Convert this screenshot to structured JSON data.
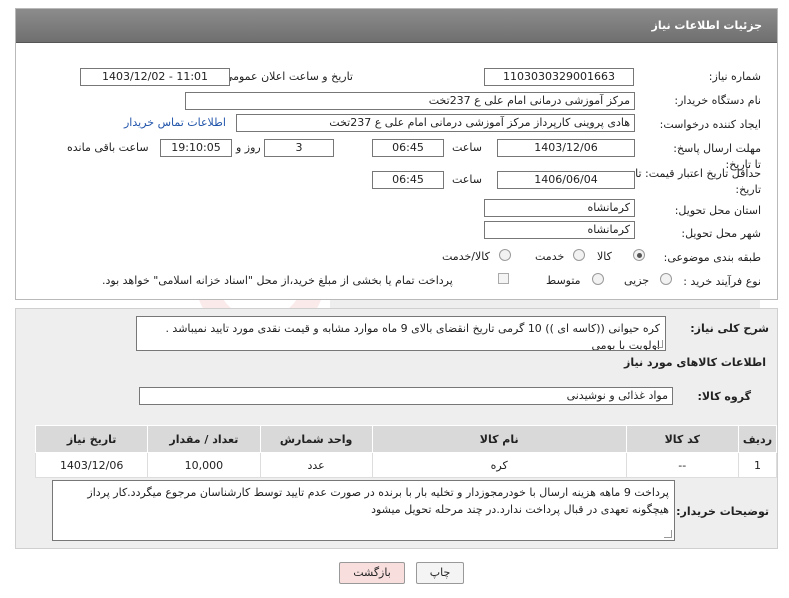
{
  "header": {
    "title": "جزئیات اطلاعات نیاز"
  },
  "fields": {
    "need_number_label": "شماره نیاز:",
    "need_number": "1103030329001663",
    "announce_label": "تاریخ و ساعت اعلان عمومی:",
    "announce_value": "1403/12/02 - 11:01",
    "buyer_org_label": "نام دستگاه خریدار:",
    "buyer_org": "مرکز آموزشی درمانی امام علی ع 237تخت",
    "creator_label": "ایجاد کننده درخواست:",
    "creator": "هادی پروینی کارپرداز  مرکز آموزشی درمانی امام علی ع 237تخت",
    "contact_link": "اطلاعات تماس خریدار",
    "deadline_label": "مهلت ارسال پاسخ: تا تاریخ:",
    "deadline_date": "1403/12/06",
    "time_label": "ساعت",
    "deadline_time": "06:45",
    "days_value": "3",
    "days_label": "روز و",
    "remaining_time": "19:10:05",
    "remaining_label": "ساعت باقی مانده",
    "validity_label": "حداقل تاریخ اعتبار قیمت: تا تاریخ:",
    "validity_date": "1406/06/04",
    "validity_time": "06:45",
    "province_label": "استان محل تحویل:",
    "province": "کرمانشاه",
    "city_label": "شهر محل تحویل:",
    "city": "کرمانشاه",
    "category_label": "طبقه بندی موضوعی:",
    "category_options": [
      "کالا",
      "خدمت",
      "کالا/خدمت"
    ],
    "process_label": "نوع فرآیند خرید :",
    "process_options": [
      "جزیی",
      "متوسط"
    ],
    "payment_note": "پرداخت تمام یا بخشی از مبلغ خرید،از محل \"اسناد خزانه اسلامی\" خواهد بود."
  },
  "summary": {
    "label": "شرح کلی نیاز:",
    "text": "کره حیوانی ((کاسه ای ))  10 گرمی  تاریخ انقضای بالای 9 ماه  موارد مشابه و قیمت نقدی مورد تایید نمیباشد . اولویت با بومی"
  },
  "goods_info_title": "اطلاعات کالاهای مورد نیاز",
  "goods_group": {
    "label": "گروه کالا:",
    "value": "مواد غذائی و نوشیدنی"
  },
  "table": {
    "headers": [
      "ردیف",
      "کد کالا",
      "نام کالا",
      "واحد شمارش",
      "تعداد / مقدار",
      "تاریخ نیاز"
    ],
    "rows": [
      [
        "1",
        "--",
        "کره",
        "عدد",
        "10,000",
        "1403/12/06"
      ]
    ]
  },
  "buyer_notes": {
    "label": "توضیحات خریدار:",
    "text": "پرداخت 9 ماهه هزینه ارسال  با خودرمجوزدار و تخلیه بار با برنده در صورت عدم تایید  توسط کارشناسان مرجوع میگردد.کار پرداز هیچگونه تعهدی در قبال پرداخت ندارد.در چند مرحله تحویل میشود"
  },
  "buttons": {
    "print": "چاپ",
    "back": "بازگشت"
  },
  "colors": {
    "header": "#7d7d7d",
    "back_button": "#f9dede",
    "link": "#2255aa"
  }
}
